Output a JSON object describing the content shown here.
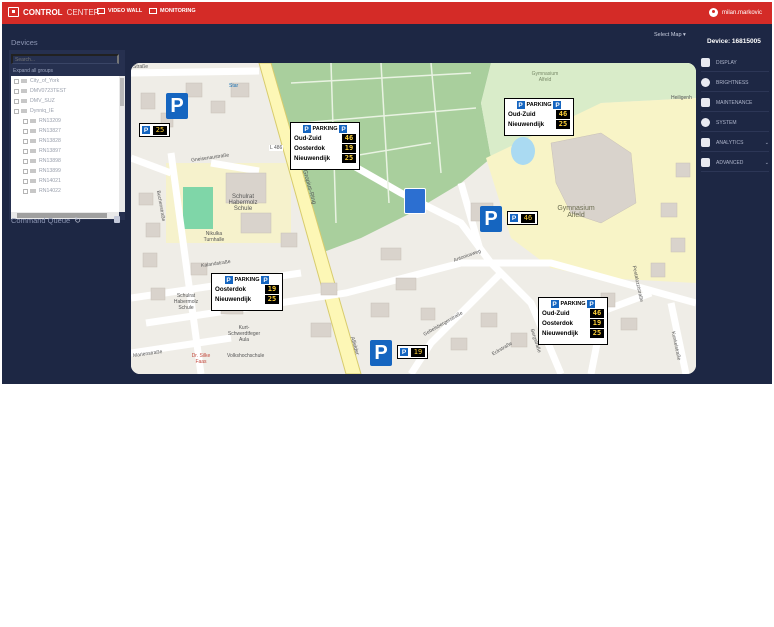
{
  "header": {
    "brand_bold": "CONTROL",
    "brand_light": "CENTER",
    "nav": [
      {
        "label": "VIDEO WALL",
        "icon": "video-wall-icon"
      },
      {
        "label": "MONITORING",
        "icon": "monitor-icon"
      }
    ],
    "user": "milan.markovic"
  },
  "sidebar": {
    "title": "Devices",
    "search_placeholder": "Search...",
    "expand_all": "Expand all groups",
    "tree": [
      {
        "label": "City_of_York",
        "level": 0
      },
      {
        "label": "DMV0723TEST",
        "level": 0
      },
      {
        "label": "DMV_SUZ",
        "level": 0
      },
      {
        "label": "Dynniq_IE",
        "level": 0
      },
      {
        "label": "RN13209",
        "level": 1
      },
      {
        "label": "RN13827",
        "level": 1
      },
      {
        "label": "RN13828",
        "level": 1
      },
      {
        "label": "RN13897",
        "level": 1
      },
      {
        "label": "RN13898",
        "level": 1
      },
      {
        "label": "RN13899",
        "level": 1
      },
      {
        "label": "RN14021",
        "level": 1
      },
      {
        "label": "RN14022",
        "level": 1
      }
    ],
    "command_queue": "Command Queue"
  },
  "map": {
    "select_map": "Select Map",
    "labels": {
      "street1": "Straße",
      "star": "Star",
      "gneisenau": "Gneisenaustraße",
      "buchen": "Buchenstraße",
      "schulrat": "Schulrat Habermolz Schule",
      "nikulka": "Nikulka Turnhalle",
      "kalandstrasse": "Kalandstraße",
      "gymnasium": "Gymnasium Alfeld",
      "heilige": "Heiligenh",
      "walter": "Walter-Gropius-Ring",
      "l486": "L 486",
      "arkonstr": "Antoniusweg",
      "schulrat2": "Schulrat Habermolz Schule",
      "kurt": "Kurt-Schwerdtfeger Aula",
      "volk": "Volkshochschule",
      "marien": "Marienstraße",
      "silke": "Dr. Silke Faas",
      "eckstr": "Eckstraße",
      "bergstr": "Bergstraße",
      "gebelsberg": "Gebelsbergerstraße",
      "sedan": "Sedanstraße",
      "pestalozzi": "Pestalozzistraße",
      "kunkelstrasse": "Kunkelstraße",
      "gymnasium_top": "Gymnasium Alfeld",
      "alfelder": "Alfelder"
    }
  },
  "signs": {
    "parking_label": "PARKING",
    "p_letter": "P",
    "big": [
      {
        "rows": [
          {
            "name": "Oud-Zuid",
            "value": "46"
          },
          {
            "name": "Oosterdok",
            "value": "19"
          },
          {
            "name": "Nieuwendijk",
            "value": "25"
          }
        ]
      },
      {
        "rows": [
          {
            "name": "Oud-Zuid",
            "value": "46"
          },
          {
            "name": "Nieuwendijk",
            "value": "25"
          }
        ]
      },
      {
        "rows": [
          {
            "name": "Oosterdok",
            "value": "19"
          },
          {
            "name": "Nieuwendijk",
            "value": "25"
          }
        ]
      },
      {
        "rows": [
          {
            "name": "Oud-Zuid",
            "value": "46"
          },
          {
            "name": "Oosterdok",
            "value": "19"
          },
          {
            "name": "Nieuwendijk",
            "value": "25"
          }
        ]
      }
    ],
    "small": [
      {
        "value": "25"
      },
      {
        "value": "46"
      },
      {
        "value": "19"
      }
    ]
  },
  "right_panel": {
    "device": "Device: 16815005",
    "items": [
      {
        "label": "DISPLAY",
        "icon": "display-icon"
      },
      {
        "label": "BRIGHTNESS",
        "icon": "brightness-icon"
      },
      {
        "label": "MAINTENANCE",
        "icon": "wrench-icon"
      },
      {
        "label": "SYSTEM",
        "icon": "info-icon"
      },
      {
        "label": "ANALYTICS",
        "icon": "chart-icon",
        "expandable": true
      },
      {
        "label": "ADVANCED",
        "icon": "gears-icon",
        "expandable": true
      }
    ]
  },
  "colors": {
    "header_red": "#d42b27",
    "panel_navy": "#1d2744",
    "parking_blue": "#1565c0",
    "led_yellow": "#ffd23a"
  }
}
